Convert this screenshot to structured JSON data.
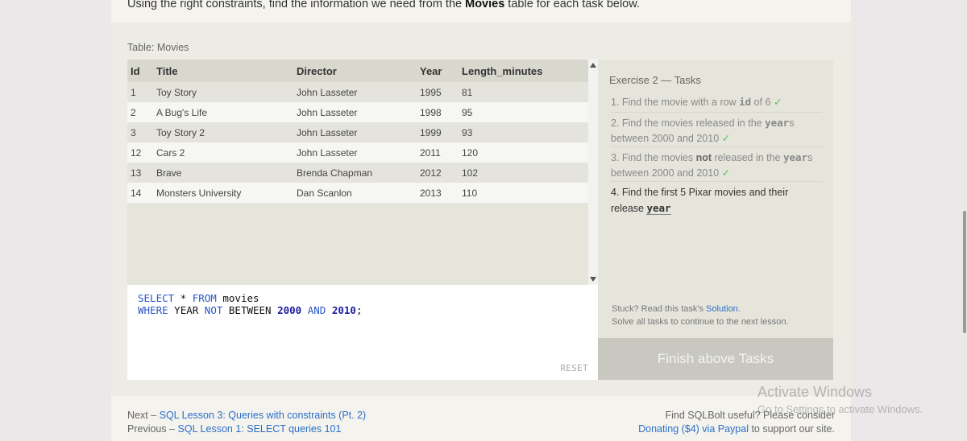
{
  "intro": {
    "before": "Using the right constraints, find the information we need from the ",
    "bold": "Movies",
    "after": " table for each task below."
  },
  "table": {
    "caption": "Table: Movies",
    "columns": [
      "Id",
      "Title",
      "Director",
      "Year",
      "Length_minutes"
    ],
    "rows": [
      [
        "1",
        "Toy Story",
        "John Lasseter",
        "1995",
        "81"
      ],
      [
        "2",
        "A Bug's Life",
        "John Lasseter",
        "1998",
        "95"
      ],
      [
        "3",
        "Toy Story 2",
        "John Lasseter",
        "1999",
        "93"
      ],
      [
        "12",
        "Cars 2",
        "John Lasseter",
        "2011",
        "120"
      ],
      [
        "13",
        "Brave",
        "Brenda Chapman",
        "2012",
        "102"
      ],
      [
        "14",
        "Monsters University",
        "Dan Scanlon",
        "2013",
        "110"
      ]
    ]
  },
  "editor": {
    "line1": {
      "kw1": "SELECT",
      "mid": " * ",
      "kw2": "FROM",
      "end": " movies"
    },
    "line2": {
      "kw1": "WHERE",
      "t1": " YEAR ",
      "kw2": "NOT",
      "t2": " BETWEEN ",
      "n1": "2000",
      "kw3": " AND ",
      "n2": "2010",
      "end": ";"
    },
    "reset_label": "RESET"
  },
  "tasks": {
    "title": "Exercise 2 — Tasks",
    "t1": {
      "a": "1. Find the movie with a row ",
      "code": "id",
      "b": " of 6 ",
      "check": "✓"
    },
    "t2": {
      "a": "2. Find the movies released in the ",
      "code": "year",
      "b": "s between 2000 and 2010 ",
      "check": "✓"
    },
    "t3": {
      "a": "3. Find the movies ",
      "bold": "not",
      "b": " released in the ",
      "code": "year",
      "c": "s between 2000 and 2010 ",
      "check": "✓"
    },
    "t4": {
      "a": "4. Find the first 5 Pixar movies and their release ",
      "code": "year"
    },
    "stuck_prefix": "Stuck? Read this task's ",
    "solution_link": "Solution",
    "stuck_suffix": ".",
    "stuck_line2": "Solve all tasks to continue to the next lesson.",
    "finish_label": "Finish above Tasks"
  },
  "footer": {
    "next_prefix": "Next – ",
    "next_link": "SQL Lesson 3: Queries with constraints (Pt. 2)",
    "prev_prefix": "Previous – ",
    "prev_link": "SQL Lesson 1: SELECT queries 101",
    "useful": "Find SQLBolt useful? Please consider",
    "donate_link": "Donating ($4) via Paypal",
    "donate_suffix": " to support our site."
  },
  "watermark": {
    "title": "Activate Windows",
    "sub": "Go to Settings to activate Windows."
  },
  "colors": {
    "keyword": "#2a56c6",
    "link": "#2b6fc9",
    "check": "#5bbf5b"
  }
}
